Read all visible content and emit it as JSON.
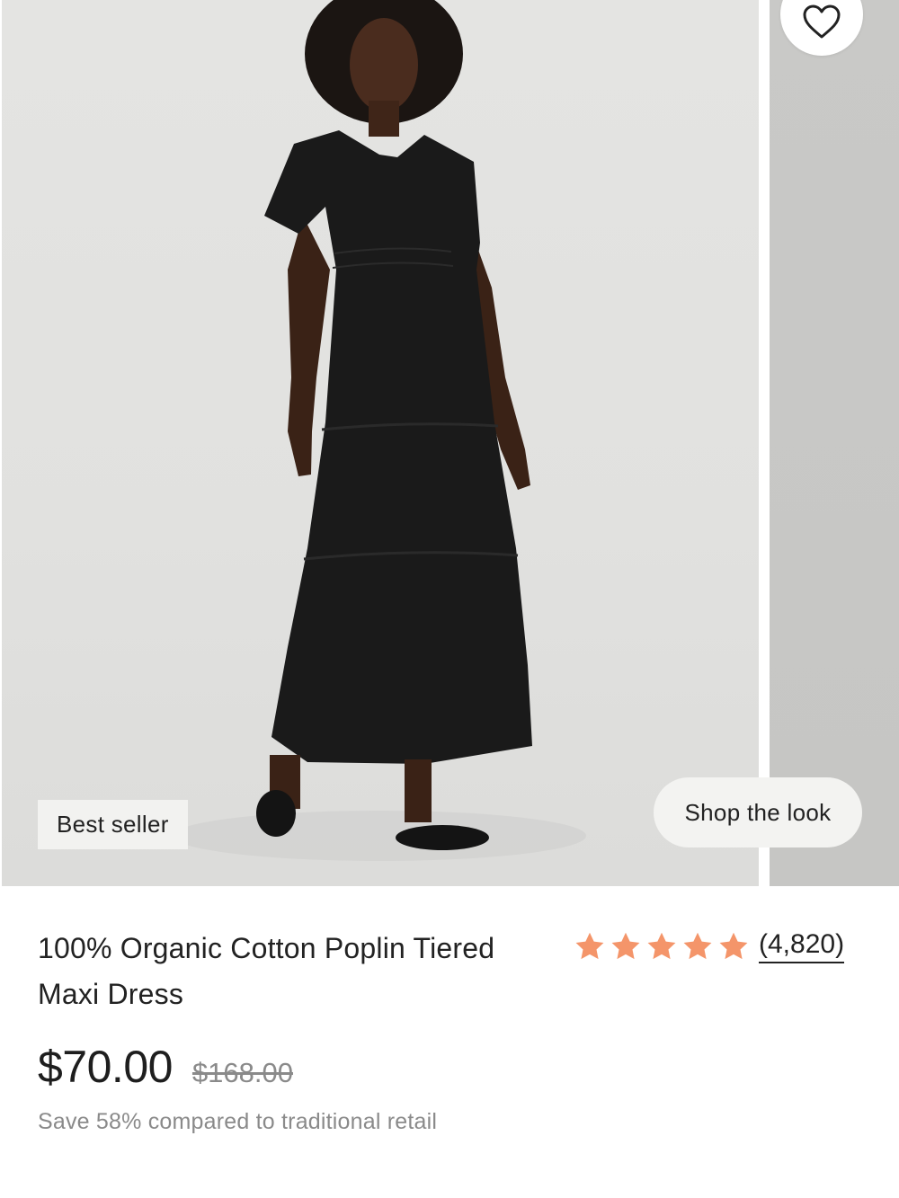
{
  "gallery": {
    "badge": "Best seller",
    "shop_the_look": "Shop the look",
    "favorite_icon": "heart-outline-icon",
    "background_color": "#e2e2e0"
  },
  "product": {
    "title": "100% Organic Cotton Poplin Tiered Maxi Dress",
    "rating_stars": 5,
    "star_color": "#f4956a",
    "review_count": "(4,820)",
    "price": "$70.00",
    "original_price": "$168.00",
    "savings": "Save 58% compared to traditional retail"
  }
}
